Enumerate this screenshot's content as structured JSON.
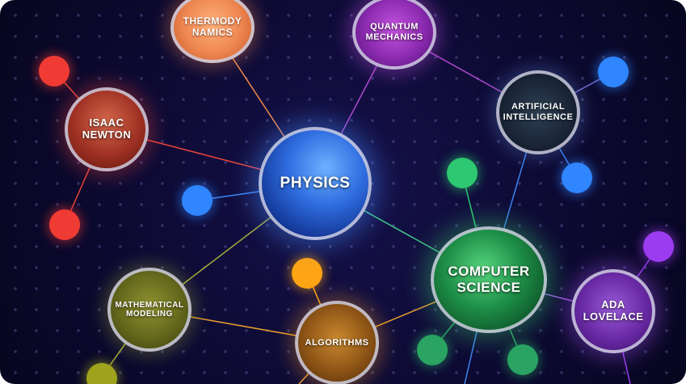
{
  "nodes": {
    "physics": "PHYSICS",
    "computer_science": "COMPUTER\nSCIENCE",
    "isaac_newton": "ISAAC\nNEWTON",
    "thermodynamics": "THERMODY\nNAMICS",
    "quantum_mechanics": "QUANTUM\nMECHANICS",
    "artificial_intelligence": "ARTIFICIAL\nINTELLIGENCE",
    "ada_lovelace": "ADA\nLOVELACE",
    "mathematical_modeling": "MATHEMATICAL\nMODELING",
    "algorithms": "ALGORITHMS"
  },
  "colors": {
    "background": "#0d0a33",
    "red": "#ef3b33",
    "blue": "#2f86ff",
    "green": "#2ec772",
    "dark_green": "#2aa363",
    "orange": "#ffa514",
    "purple": "#9b3cf0",
    "olive": "#9fa21c"
  }
}
